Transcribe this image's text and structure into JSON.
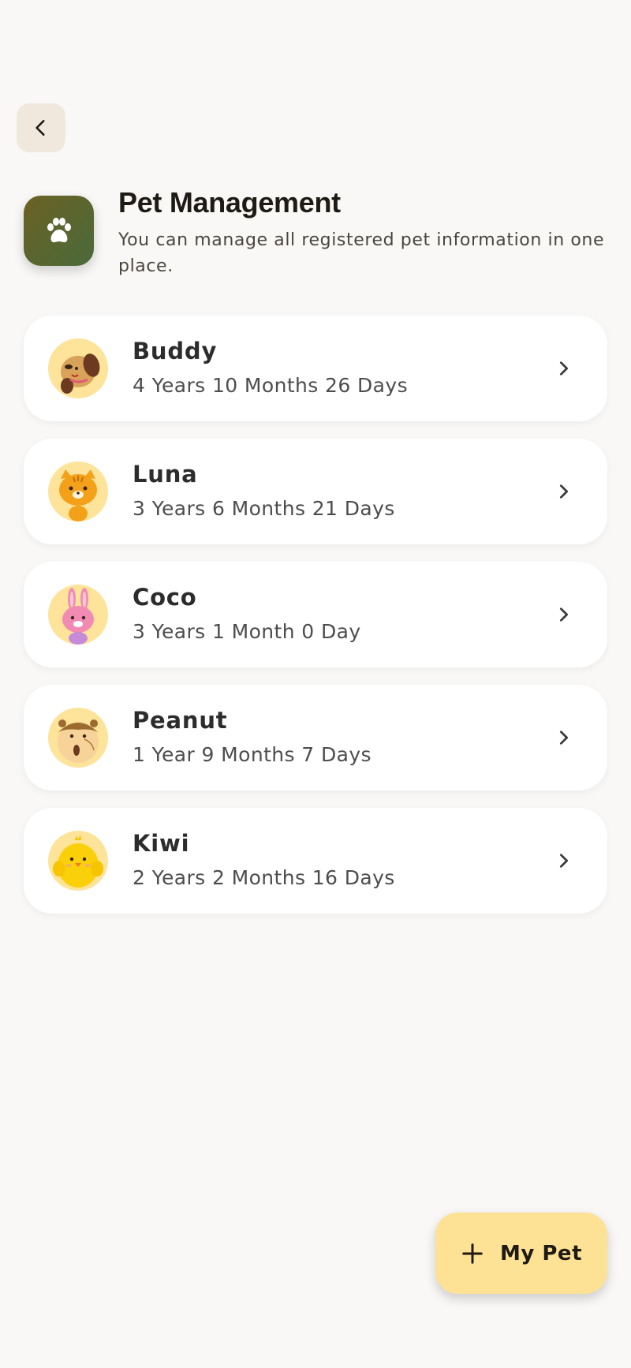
{
  "navigation": {
    "back_icon": "chevron-left-icon"
  },
  "header": {
    "icon": "paw-icon",
    "title": "Pet Management",
    "subtitle": "You can manage all registered pet information in one place."
  },
  "pets": [
    {
      "name": "Buddy",
      "age": "4 Years 10 Months 26 Days",
      "avatar": "dog-avatar"
    },
    {
      "name": "Luna",
      "age": "3 Years 6 Months 21 Days",
      "avatar": "cat-avatar"
    },
    {
      "name": "Coco",
      "age": "3 Years 1 Month 0 Day",
      "avatar": "rabbit-avatar"
    },
    {
      "name": "Peanut",
      "age": "1 Year 9 Months 7 Days",
      "avatar": "hamster-avatar"
    },
    {
      "name": "Kiwi",
      "age": "2 Years 2 Months 16 Days",
      "avatar": "chick-avatar"
    }
  ],
  "fab": {
    "label": "My Pet",
    "icon": "plus-icon"
  },
  "colors": {
    "background": "#f9f8f6",
    "card": "#ffffff",
    "accent": "#fde195",
    "avatar_bg": "#fde49a",
    "app_icon": "#5b6530"
  }
}
